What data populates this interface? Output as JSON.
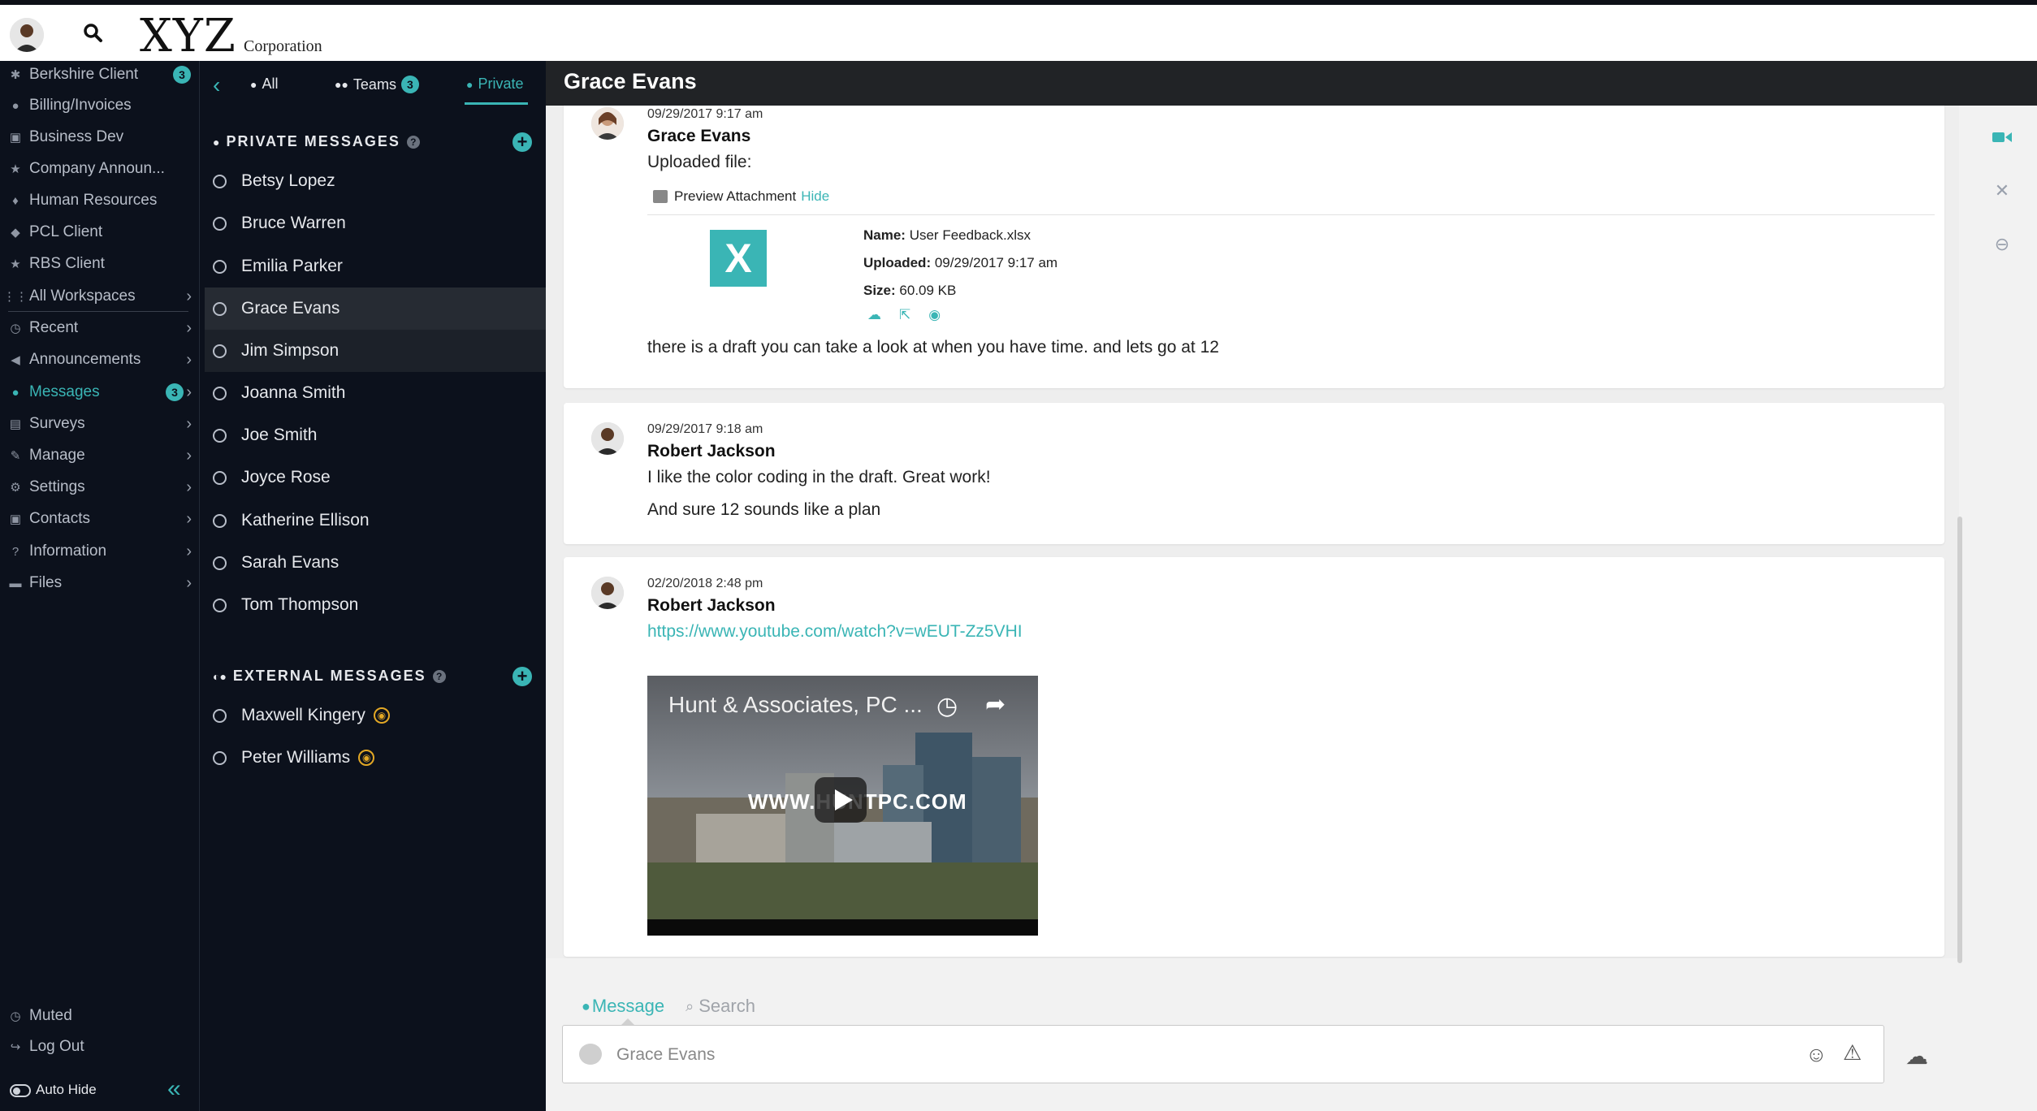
{
  "topbar": {
    "logo_text": "XYZ",
    "logo_sub": "Corporation",
    "search_icon": "search-icon"
  },
  "leftnav": {
    "workspaces": [
      {
        "label": "Berkshire Client",
        "icon": "gear-icon",
        "badge": "3"
      },
      {
        "label": "Billing/Invoices",
        "icon": "globe-icon"
      },
      {
        "label": "Business Dev",
        "icon": "briefcase-icon"
      },
      {
        "label": "Company Announ...",
        "icon": "star-icon"
      },
      {
        "label": "Human Resources",
        "icon": "pin-icon"
      },
      {
        "label": "PCL Client",
        "icon": "cube-icon"
      },
      {
        "label": "RBS Client",
        "icon": "star-icon"
      }
    ],
    "sections": [
      {
        "label": "All Workspaces",
        "icon": "grid-icon"
      },
      {
        "label": "Recent",
        "icon": "clock-icon"
      },
      {
        "label": "Announcements",
        "icon": "megaphone-icon"
      },
      {
        "label": "Messages",
        "icon": "chat-icon",
        "badge": "3",
        "active": true
      },
      {
        "label": "Surveys",
        "icon": "clipboard-icon"
      },
      {
        "label": "Manage",
        "icon": "pencil-icon"
      },
      {
        "label": "Settings",
        "icon": "gear-icon"
      },
      {
        "label": "Contacts",
        "icon": "address-book-icon"
      },
      {
        "label": "Information",
        "icon": "question-icon"
      },
      {
        "label": "Files",
        "icon": "folder-icon"
      }
    ],
    "bottom": {
      "muted": "Muted",
      "logout": "Log Out",
      "autohide": "Auto Hide"
    }
  },
  "convlist": {
    "tabs": [
      {
        "label": "All",
        "icon": "chat-icon"
      },
      {
        "label": "Teams",
        "icon": "team-icon",
        "badge": "3"
      },
      {
        "label": "Private",
        "icon": "person-icon",
        "active": true
      }
    ],
    "private_heading": "PRIVATE MESSAGES",
    "private_contacts": [
      "Betsy Lopez",
      "Bruce Warren",
      "Emilia Parker",
      "Grace Evans",
      "Jim Simpson",
      "Joanna Smith",
      "Joe Smith",
      "Joyce Rose",
      "Katherine Ellison",
      "Sarah Evans",
      "Tom Thompson"
    ],
    "selected_contact": "Grace Evans",
    "external_heading": "EXTERNAL MESSAGES",
    "external_contacts": [
      "Maxwell Kingery",
      "Peter Williams"
    ]
  },
  "main": {
    "title": "Grace Evans",
    "messages": [
      {
        "time": "09/29/2017 9:17 am",
        "author": "Grace Evans",
        "text": "Uploaded file:",
        "attachment": {
          "preview_label": "Preview Attachment",
          "hide_label": "Hide",
          "icon_letter": "X",
          "name_label": "Name:",
          "name": "User Feedback.xlsx",
          "uploaded_label": "Uploaded:",
          "uploaded": "09/29/2017 9:17 am",
          "size_label": "Size:",
          "size": "60.09 KB"
        },
        "text2": "there is a draft you can take a look at when you have time. and lets go at 12"
      },
      {
        "time": "09/29/2017 9:18 am",
        "author": "Robert Jackson",
        "text": "I like the color coding in the draft. Great work!",
        "text2": "And sure 12 sounds like a plan"
      },
      {
        "time": "02/20/2018 2:48 pm",
        "author": "Robert Jackson",
        "link": "https://www.youtube.com/watch?v=wEUT-Zz5VHI",
        "video_title": "Hunt & Associates, PC ...",
        "video_watermark": "WWW.HUNTPC.COM"
      }
    ]
  },
  "composer": {
    "tab_message": "Message",
    "tab_search": "Search",
    "placeholder": "Grace Evans"
  },
  "colors": {
    "accent": "#3ab5b5",
    "nav_bg": "#0c111c",
    "header_bg": "#212326"
  }
}
